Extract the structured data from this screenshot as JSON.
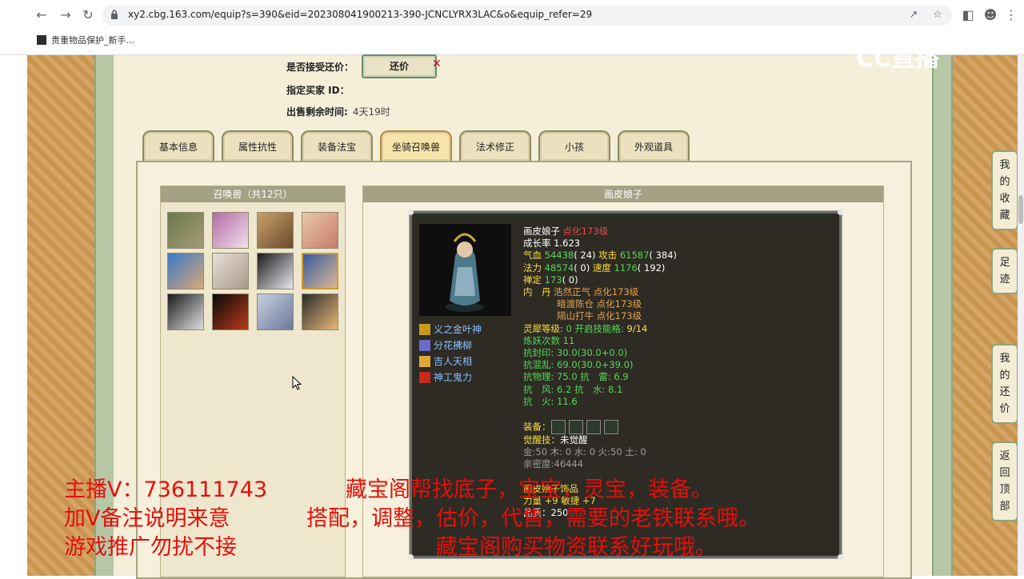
{
  "browser": {
    "url": "xy2.cbg.163.com/equip?s=390&eid=202308041900213-390-JCNCLYRX3LAC&o&equip_refer=29",
    "bookmark": "贵重物品保护_新手..."
  },
  "listing": {
    "accept_offer_label": "是否接受还价：",
    "offer_button": "还价",
    "buyer_label": "指定买家 ID：",
    "time_left_label": "出售剩余时间:",
    "time_left_value": "4天19时"
  },
  "tabs": [
    "基本信息",
    "属性抗性",
    "装备法宝",
    "坐骑召唤兽",
    "法术修正",
    "小孩",
    "外观道具"
  ],
  "pets_panel": {
    "title": "召唤兽（共12只）"
  },
  "detail": {
    "header": "画皮娘子",
    "name": "画皮娘子",
    "transform": "点化173级",
    "growth": "成长率 1.623",
    "hp_label": "气血",
    "hp_value": "54438",
    "hp_extra": "( 24)",
    "atk_label": "攻击",
    "atk_value": "61587",
    "atk_extra": "( 384)",
    "mp_label": "法力",
    "mp_value": "48574",
    "mp_extra": "( 0)",
    "spd_label": "速度",
    "spd_value": "1176",
    "spd_extra": "( 192)",
    "zen_label": "禅定",
    "zen_value": "173",
    "zen_extra": "( 0)",
    "neidan_label": "内　丹",
    "neidan": [
      "浩然正气 点化173级",
      "暗渡陈仓 点化173级",
      "隔山打牛 点化173级"
    ],
    "spirit_label": "灵犀等级:",
    "spirit_value": "0 开启技能格:",
    "spirit_slots": "9/14",
    "refine": "炼妖次数 11",
    "res_seal": "抗封印: 30.0(30.0+0.0)",
    "res_chaos": "抗混乱: 69.0(30.0+39.0)",
    "res_phys": "抗物理: 75.0 抗　雷: 6.9",
    "res_wind": "抗　风: 6.2 抗　水: 8.1",
    "res_fire": "抗　火: 11.6",
    "equip_label": "装备：",
    "awaken_label": "觉醒技：",
    "awaken_value": "未觉醒",
    "elements": "金:50 木: 0 水: 0 火:50 土: 0",
    "intimacy": "亲密度:46444",
    "ornament": "画皮娘子饰品",
    "ornament_attr": "力量 +9 敏捷 +7",
    "quality": "品质：250",
    "skills": [
      "义之金叶神",
      "分花拂柳",
      "吉人天相",
      "神工鬼力"
    ]
  },
  "side_nav": [
    "我的收藏",
    "足迹",
    "我的还价",
    "返回顶部"
  ],
  "watermark": "CC直播",
  "overlay": {
    "line1a": "主播V：736111743",
    "line1b": "藏宝阁帮找底子，宝宝，灵宝，装备。",
    "line2a": "加V备注说明来意",
    "line2b": "搭配，调整，估价，代售，需要的老铁联系哦。",
    "line3a": "游戏推广勿扰不接",
    "line3b": "藏宝阁购买物资联系好玩哦。"
  },
  "colors": {
    "overlay_red": "#e4100a",
    "card_bg": "#2d2b24",
    "accent_green": "#56d856"
  }
}
